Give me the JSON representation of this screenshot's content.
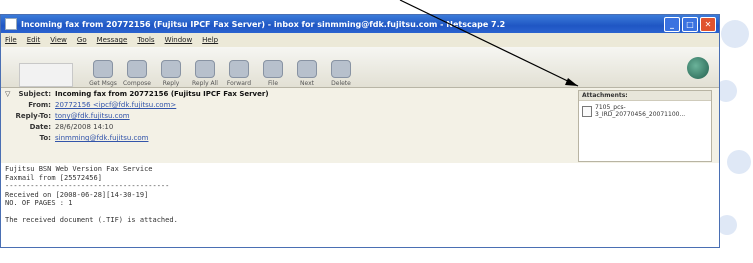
{
  "window": {
    "title": "Incoming fax from 20772156 (Fujitsu IPCF Fax Server) - inbox for sinmming@fdk.fujitsu.com - Netscape 7.2"
  },
  "menu": [
    "File",
    "Edit",
    "View",
    "Go",
    "Message",
    "Tools",
    "Window",
    "Help"
  ],
  "toolbar": {
    "buttons": [
      "Get Msgs",
      "Compose",
      "Reply",
      "Reply All",
      "Forward",
      "File",
      "Next",
      "Delete"
    ]
  },
  "header": {
    "subject_label": "Subject:",
    "subject": "Incoming fax from 20772156 (Fujitsu IPCF Fax Server)",
    "from_label": "From:",
    "from": "20772156 <ipcf@fdk.fujitsu.com>",
    "replyto_label": "Reply-To:",
    "replyto": "tony@fdk.fujitsu.com",
    "date_label": "Date:",
    "date": "28/6/2008 14:10",
    "to_label": "To:",
    "to": "sinmming@fdk.fujitsu.com"
  },
  "attachments": {
    "title": "Attachments:",
    "file": "7105_pcs-3_IRD_20770456_20071100..."
  },
  "body": {
    "lines": [
      "Fujitsu BSN Web Version Fax Service",
      "Faxmail from [25572456]",
      "---------------------------------------",
      "Received on [2008-06-28][14-30-19]",
      "NO. OF PAGES : 1",
      "",
      "The received document (.TIF) is attached."
    ]
  },
  "colors": {
    "titlebar": "#1f56c4",
    "window_bg": "#ece9d8",
    "link": "#3355aa"
  }
}
